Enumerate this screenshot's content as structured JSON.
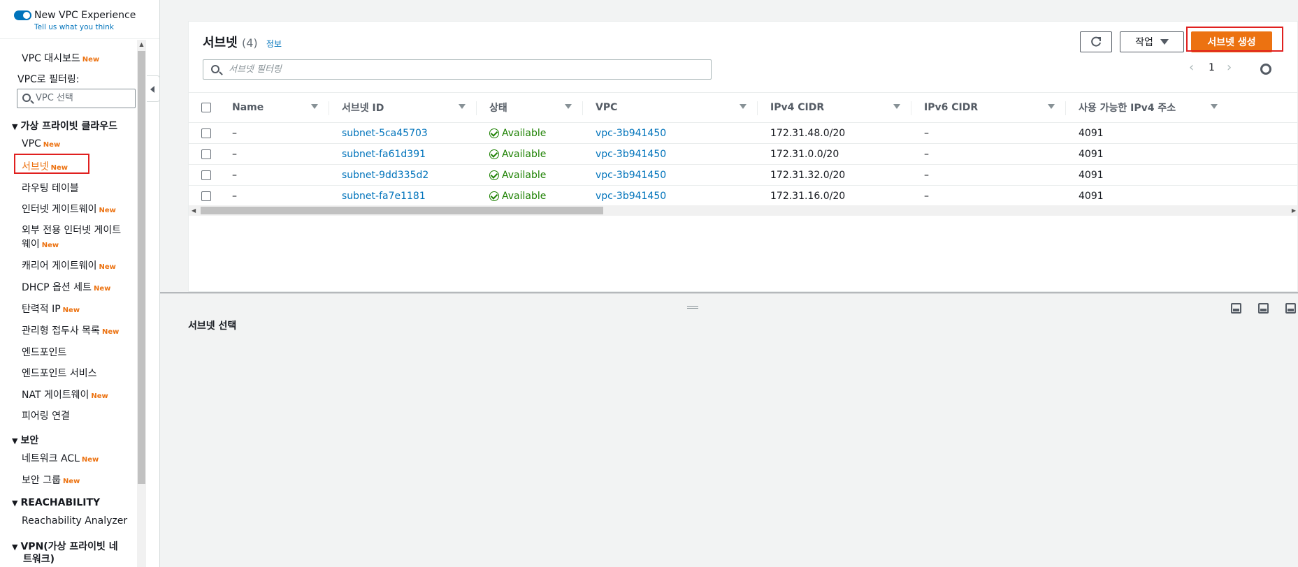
{
  "sidebar": {
    "toggle_label": "New VPC Experience",
    "feedback_link": "Tell us what you think",
    "dashboard": "VPC 대시보드",
    "filter_label": "VPC로 필터링:",
    "filter_placeholder": "VPC 선택",
    "new_badge": "New",
    "section_vpc": "가상 프라이빗 클라우드",
    "items_vpc": [
      "VPC",
      "서브넷",
      "라우팅 테이블",
      "인터넷 게이트웨이",
      "외부 전용 인터넷 게이트",
      "웨이",
      "캐리어 게이트웨이",
      "DHCP 옵션 세트",
      "탄력적 IP",
      "관리형 접두사 목록",
      "엔드포인트",
      "엔드포인트 서비스",
      "NAT 게이트웨이",
      "피어링 연결"
    ],
    "section_security": "보안",
    "items_security": [
      "네트워크 ACL",
      "보안 그룹"
    ],
    "section_reach": "REACHABILITY",
    "items_reach": [
      "Reachability Analyzer"
    ],
    "section_vpn_line1": "VPN(가상 프라이빗 네",
    "section_vpn_line2": "트워크)"
  },
  "panel": {
    "title": "서브넷",
    "count": "(4)",
    "info": "정보",
    "actions_label": "작업",
    "create_label": "서브넷 생성",
    "search_placeholder": "서브넷 필터링",
    "page_number": "1"
  },
  "table": {
    "columns": [
      "Name",
      "서브넷 ID",
      "상태",
      "VPC",
      "IPv4 CIDR",
      "IPv6 CIDR",
      "사용 가능한 IPv4 주소"
    ],
    "rows": [
      {
        "name": "–",
        "subnet_id": "subnet-5ca45703",
        "status": "Available",
        "vpc": "vpc-3b941450",
        "ipv4": "172.31.48.0/20",
        "ipv6": "–",
        "available": "4091"
      },
      {
        "name": "–",
        "subnet_id": "subnet-fa61d391",
        "status": "Available",
        "vpc": "vpc-3b941450",
        "ipv4": "172.31.0.0/20",
        "ipv6": "–",
        "available": "4091"
      },
      {
        "name": "–",
        "subnet_id": "subnet-9dd335d2",
        "status": "Available",
        "vpc": "vpc-3b941450",
        "ipv4": "172.31.32.0/20",
        "ipv6": "–",
        "available": "4091"
      },
      {
        "name": "–",
        "subnet_id": "subnet-fa7e1181",
        "status": "Available",
        "vpc": "vpc-3b941450",
        "ipv4": "172.31.16.0/20",
        "ipv6": "–",
        "available": "4091"
      }
    ]
  },
  "split": {
    "title": "서브넷 선택"
  },
  "colors": {
    "accent": "#ec7211",
    "link": "#0073bb",
    "success": "#1d8102",
    "highlight": "#e0201f"
  }
}
